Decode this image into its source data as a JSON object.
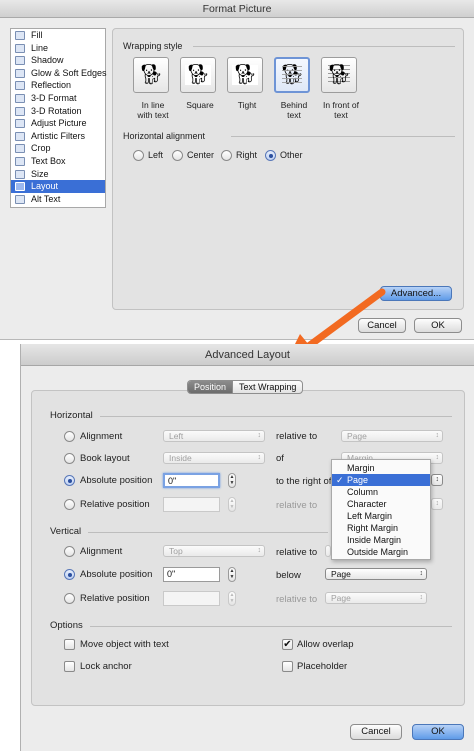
{
  "format_picture": {
    "title": "Format Picture",
    "sidebar": [
      {
        "label": "Fill",
        "icon": "fill-icon"
      },
      {
        "label": "Line",
        "icon": "line-icon"
      },
      {
        "label": "Shadow",
        "icon": "shadow-icon"
      },
      {
        "label": "Glow & Soft Edges",
        "icon": "glow-icon"
      },
      {
        "label": "Reflection",
        "icon": "reflection-icon"
      },
      {
        "label": "3-D Format",
        "icon": "3d-format-icon"
      },
      {
        "label": "3-D Rotation",
        "icon": "3d-rotation-icon"
      },
      {
        "label": "Adjust Picture",
        "icon": "adjust-picture-icon"
      },
      {
        "label": "Artistic Filters",
        "icon": "artistic-filters-icon"
      },
      {
        "label": "Crop",
        "icon": "crop-icon"
      },
      {
        "label": "Text Box",
        "icon": "text-box-icon"
      },
      {
        "label": "Size",
        "icon": "size-icon"
      },
      {
        "label": "Layout",
        "icon": "layout-icon",
        "selected": true
      },
      {
        "label": "Alt Text",
        "icon": "alt-text-icon"
      }
    ],
    "wrapping_style_label": "Wrapping style",
    "wrapping_options": [
      {
        "label1": "In line",
        "label2": "with text"
      },
      {
        "label1": "Square",
        "label2": ""
      },
      {
        "label1": "Tight",
        "label2": ""
      },
      {
        "label1": "Behind",
        "label2": "text",
        "selected": true
      },
      {
        "label1": "In front of",
        "label2": "text"
      }
    ],
    "horizontal_alignment_label": "Horizontal alignment",
    "alignment_options": [
      "Left",
      "Center",
      "Right",
      "Other"
    ],
    "alignment_selected": "Other",
    "advanced_button": "Advanced...",
    "cancel_button": "Cancel",
    "ok_button": "OK"
  },
  "advanced_layout": {
    "title": "Advanced Layout",
    "tabs": [
      "Position",
      "Text Wrapping"
    ],
    "active_tab": "Position",
    "horizontal": {
      "label": "Horizontal",
      "alignment_label": "Alignment",
      "alignment_value": "Left",
      "alignment_relative_label": "relative to",
      "alignment_relative_value": "Page",
      "book_layout_label": "Book layout",
      "book_layout_value": "Inside",
      "book_of_label": "of",
      "book_of_value": "Margin",
      "absolute_label": "Absolute position",
      "absolute_value": "0\"",
      "absolute_right_of_label": "to the right of",
      "absolute_right_of_value": "Page",
      "relative_label": "Relative position",
      "relative_relative_label": "relative to"
    },
    "dropdown_menu": {
      "items": [
        "Margin",
        "Page",
        "Column",
        "Character",
        "Left Margin",
        "Right Margin",
        "Inside Margin",
        "Outside Margin"
      ],
      "selected": "Page"
    },
    "vertical": {
      "label": "Vertical",
      "alignment_label": "Alignment",
      "alignment_value": "Top",
      "alignment_relative_label": "relative to",
      "absolute_label": "Absolute position",
      "absolute_value": "0\"",
      "absolute_below_label": "below",
      "absolute_below_value": "Page",
      "relative_label": "Relative position",
      "relative_relative_label": "relative to",
      "relative_relative_value": "Page"
    },
    "options": {
      "label": "Options",
      "move_object": "Move object with text",
      "lock_anchor": "Lock anchor",
      "allow_overlap": "Allow overlap",
      "placeholder": "Placeholder"
    },
    "cancel_button": "Cancel",
    "ok_button": "OK"
  },
  "colors": {
    "accent": "#3a6fd6",
    "arrow": "#f26a21"
  }
}
